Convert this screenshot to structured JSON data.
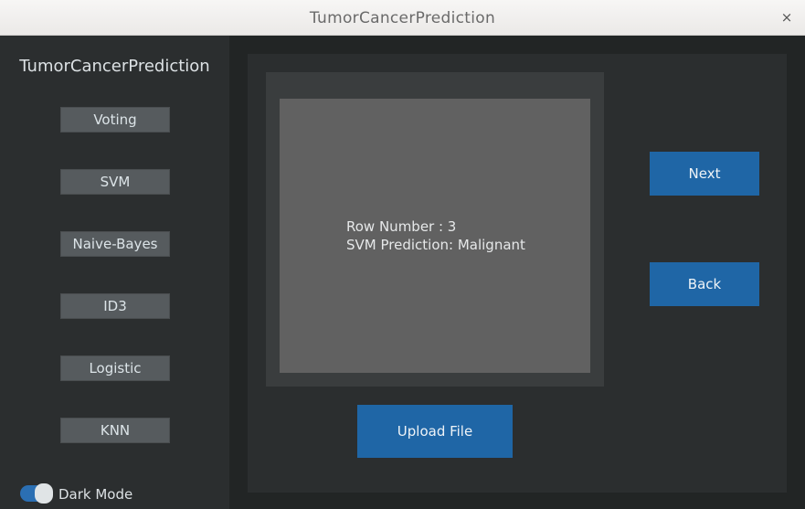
{
  "window": {
    "title": "TumorCancerPrediction",
    "close_glyph": "×"
  },
  "sidebar": {
    "title": "TumorCancerPrediction",
    "buttons": [
      {
        "label": "Voting"
      },
      {
        "label": "SVM"
      },
      {
        "label": "Naive-Bayes"
      },
      {
        "label": "ID3"
      },
      {
        "label": "Logistic"
      },
      {
        "label": "KNN"
      }
    ],
    "dark_mode": {
      "label": "Dark Mode",
      "enabled": true
    }
  },
  "main": {
    "output": {
      "line1": "Row Number : 3",
      "line2": "SVM Prediction: Malignant"
    },
    "next_label": "Next",
    "back_label": "Back",
    "upload_label": "Upload File"
  },
  "colors": {
    "accent": "#1f66a6",
    "sidebar_bg": "#2b2e2f",
    "main_bg": "#222525",
    "textbox_bg": "#616161"
  }
}
